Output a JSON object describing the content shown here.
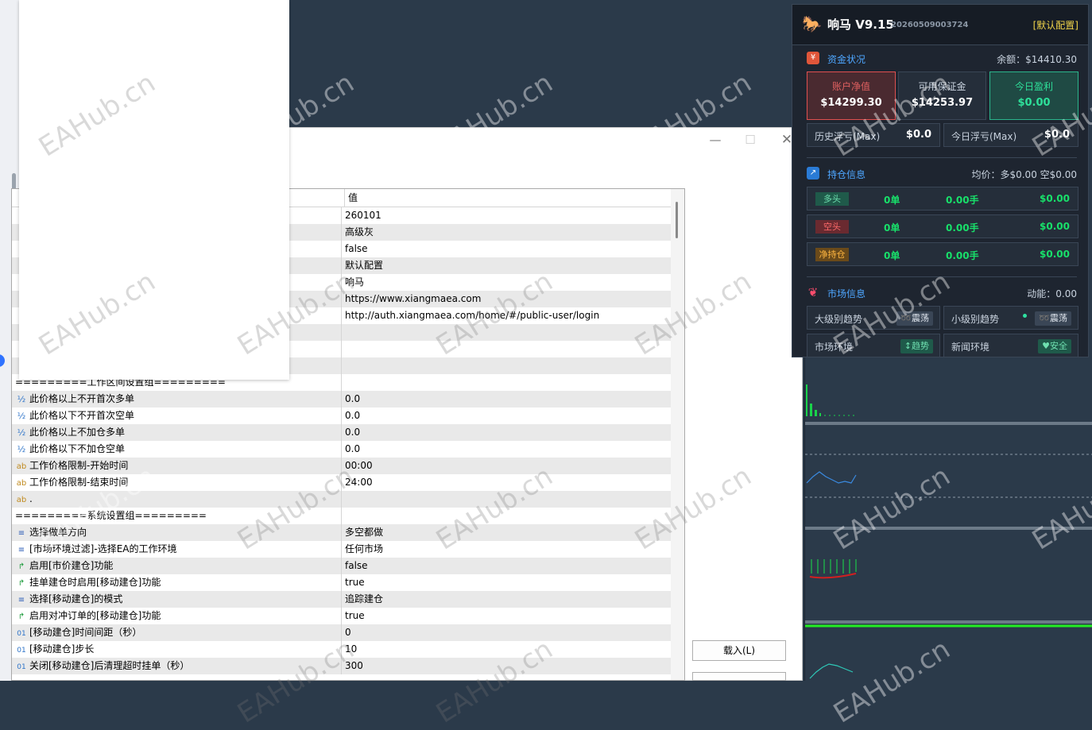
{
  "dialog": {
    "grid": {
      "header_value": "值",
      "rows": [
        {
          "icon": "",
          "name": "",
          "value": "260101"
        },
        {
          "icon": "",
          "name": "",
          "value": "高级灰"
        },
        {
          "icon": "",
          "name": "",
          "value": "false"
        },
        {
          "icon": "",
          "name": "",
          "value": "默认配置"
        },
        {
          "icon": "",
          "name": "",
          "value": "响马"
        },
        {
          "icon": "",
          "name": "",
          "value": "https://www.xiangmaea.com"
        },
        {
          "icon": "",
          "name": "",
          "value": "http://auth.xiangmaea.com/home/#/public-user/login"
        },
        {
          "icon": "",
          "name": "",
          "value": ""
        },
        {
          "icon": "",
          "name": "",
          "value": ""
        },
        {
          "icon": "",
          "name": "",
          "value": ""
        },
        {
          "icon": "",
          "name": "=========工作区间设置组=========",
          "value": ""
        },
        {
          "icon": "½",
          "name": "此价格以上不开首次多单",
          "value": "0.0"
        },
        {
          "icon": "½",
          "name": "此价格以下不开首次空单",
          "value": "0.0"
        },
        {
          "icon": "½",
          "name": "此价格以上不加仓多单",
          "value": "0.0"
        },
        {
          "icon": "½",
          "name": "此价格以下不加仓空单",
          "value": "0.0"
        },
        {
          "icon": "ab",
          "name": "工作价格限制-开始时间",
          "value": "00:00"
        },
        {
          "icon": "ab",
          "name": "工作价格限制-结束时间",
          "value": "24:00"
        },
        {
          "icon": "ab",
          "name": ".",
          "value": ""
        },
        {
          "icon": "",
          "name": "=========系统设置组=========",
          "value": ""
        },
        {
          "icon": "≡",
          "name": "选择做单方向",
          "value": "多空都做"
        },
        {
          "icon": "≡",
          "name": "[市场环境过滤]-选择EA的工作环境",
          "value": "任何市场"
        },
        {
          "icon": "↱",
          "name": "启用[市价建仓]功能",
          "value": "false"
        },
        {
          "icon": "↱",
          "name": "挂单建仓时启用[移动建仓]功能",
          "value": "true"
        },
        {
          "icon": "≡",
          "name": "选择[移动建仓]的模式",
          "value": "追踪建仓"
        },
        {
          "icon": "↱",
          "name": "启用对冲订单的[移动建仓]功能",
          "value": "true"
        },
        {
          "icon": "01",
          "name": "[移动建仓]时间间距（秒）",
          "value": "0"
        },
        {
          "icon": "01",
          "name": "[移动建仓]步长",
          "value": "10"
        },
        {
          "icon": "01",
          "name": "关闭[移动建仓]后清理超时挂单（秒）",
          "value": "300"
        }
      ]
    },
    "buttons": {
      "load": "载入(L)"
    }
  },
  "ea": {
    "title": "响马 V9.15",
    "code": "20260509003724",
    "config": "[默认配置]",
    "funds": {
      "title": "资金状况",
      "balance": "余额：$14410.30",
      "equity_label": "账户净值",
      "equity": "$14299.30",
      "margin_label": "可用保证金",
      "margin": "$14253.97",
      "today_label": "今日盈利",
      "today": "$0.00",
      "hist_dd_label": "历史浮亏(Max)",
      "hist_dd": "$0.0",
      "today_dd_label": "今日浮亏(Max)",
      "today_dd": "$0.0"
    },
    "positions": {
      "title": "持仓信息",
      "avg": "均价：多$0.00  空$0.00",
      "rows": [
        {
          "tag": "多头",
          "count": "0单",
          "lots": "0.00手",
          "pnl": "$0.00"
        },
        {
          "tag": "空头",
          "count": "0单",
          "lots": "0.00手",
          "pnl": "$0.00"
        },
        {
          "tag": "净持仓",
          "count": "0单",
          "lots": "0.00手",
          "pnl": "$0.00"
        }
      ]
    },
    "market": {
      "title": "市场信息",
      "momentum": "动能：0.00",
      "big_trend_label": "大级别趋势",
      "big_trend": "➿震荡",
      "small_trend_label": "小级别趋势",
      "small_trend": "➿震荡",
      "env_label": "市场环境",
      "env": "↕趋势",
      "news_label": "新闻环境",
      "news": "♥安全"
    }
  },
  "watermark": "EAHub.cn",
  "colors": {
    "bg": "#2b3a4a",
    "ea_panel": "#1e2530",
    "green": "#18e06a",
    "blue": "#4ea6ff",
    "red_box": "#e05050",
    "teal_box": "#2bb58c"
  }
}
